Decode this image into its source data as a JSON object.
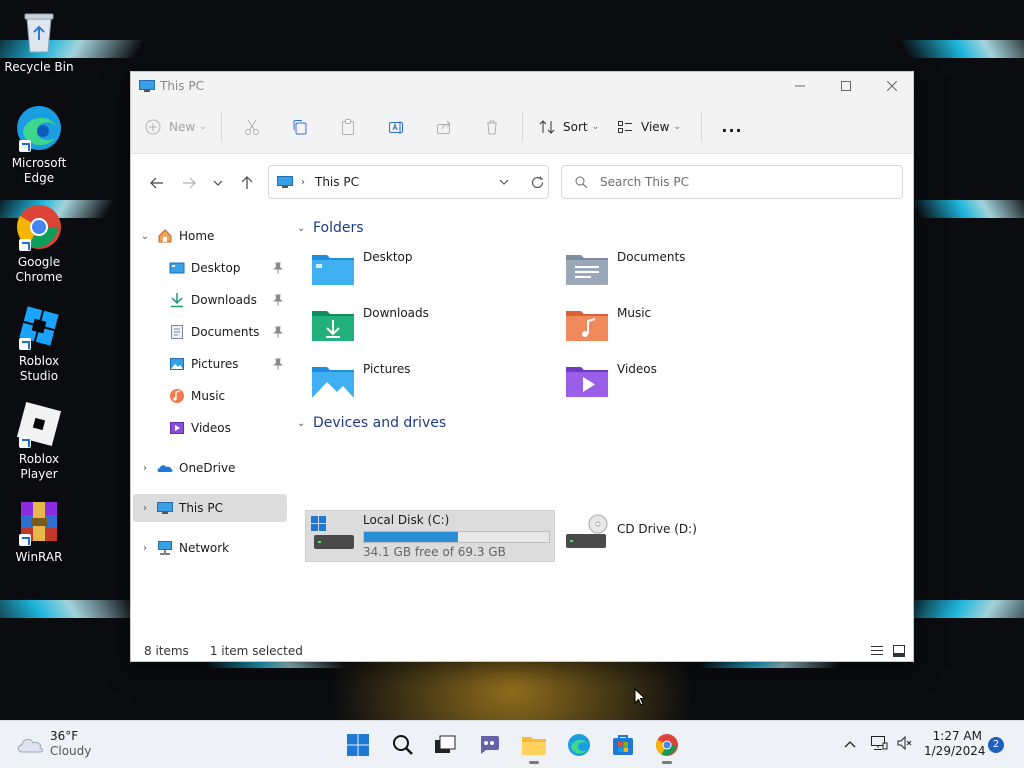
{
  "desktop": {
    "icons": [
      {
        "label": "Recycle Bin",
        "icon": "recycle-bin-icon"
      },
      {
        "label": "Microsoft Edge",
        "icon": "edge-icon"
      },
      {
        "label": "Google Chrome",
        "icon": "chrome-icon"
      },
      {
        "label": "Roblox Studio",
        "icon": "roblox-studio-icon"
      },
      {
        "label": "Roblox Player",
        "icon": "roblox-player-icon"
      },
      {
        "label": "WinRAR",
        "icon": "winrar-icon"
      }
    ]
  },
  "window": {
    "title": "This PC",
    "controls": {
      "minimize": "minimize-icon",
      "maximize": "maximize-icon",
      "close": "close-icon"
    }
  },
  "toolbar": {
    "new_label": "New",
    "sort_label": "Sort",
    "view_label": "View",
    "more_label": "..."
  },
  "address": {
    "path": "This PC",
    "search_placeholder": "Search This PC"
  },
  "sidebar": {
    "items": [
      {
        "label": "Home",
        "icon": "home-icon"
      },
      {
        "label": "Desktop",
        "icon": "desktop-folder-icon",
        "pinned": true
      },
      {
        "label": "Downloads",
        "icon": "download-icon",
        "pinned": true
      },
      {
        "label": "Documents",
        "icon": "documents-icon",
        "pinned": true
      },
      {
        "label": "Pictures",
        "icon": "pictures-icon",
        "pinned": true
      },
      {
        "label": "Music",
        "icon": "music-icon"
      },
      {
        "label": "Videos",
        "icon": "videos-icon"
      },
      {
        "label": "OneDrive",
        "icon": "onedrive-icon"
      },
      {
        "label": "This PC",
        "icon": "this-pc-icon",
        "selected": true
      },
      {
        "label": "Network",
        "icon": "network-icon"
      }
    ]
  },
  "content": {
    "folders_header": "Folders",
    "folders": [
      {
        "label": "Desktop"
      },
      {
        "label": "Documents"
      },
      {
        "label": "Downloads"
      },
      {
        "label": "Music"
      },
      {
        "label": "Pictures"
      },
      {
        "label": "Videos"
      }
    ],
    "drives_header": "Devices and drives",
    "drives": [
      {
        "label": "Local Disk (C:)",
        "free_text": "34.1 GB free of 69.3 GB",
        "used_fraction": 0.508
      },
      {
        "label": "CD Drive (D:)"
      }
    ]
  },
  "status": {
    "items_count": "8 items",
    "selected_count": "1 item selected"
  },
  "taskbar": {
    "weather_temp": "36°F",
    "weather_desc": "Cloudy",
    "time": "1:27 AM",
    "date": "1/29/2024",
    "notification_count": "2"
  },
  "colors": {
    "accent": "#2b8fd6",
    "selection": "#dcdcdc",
    "group_header": "#1e3a8a"
  }
}
